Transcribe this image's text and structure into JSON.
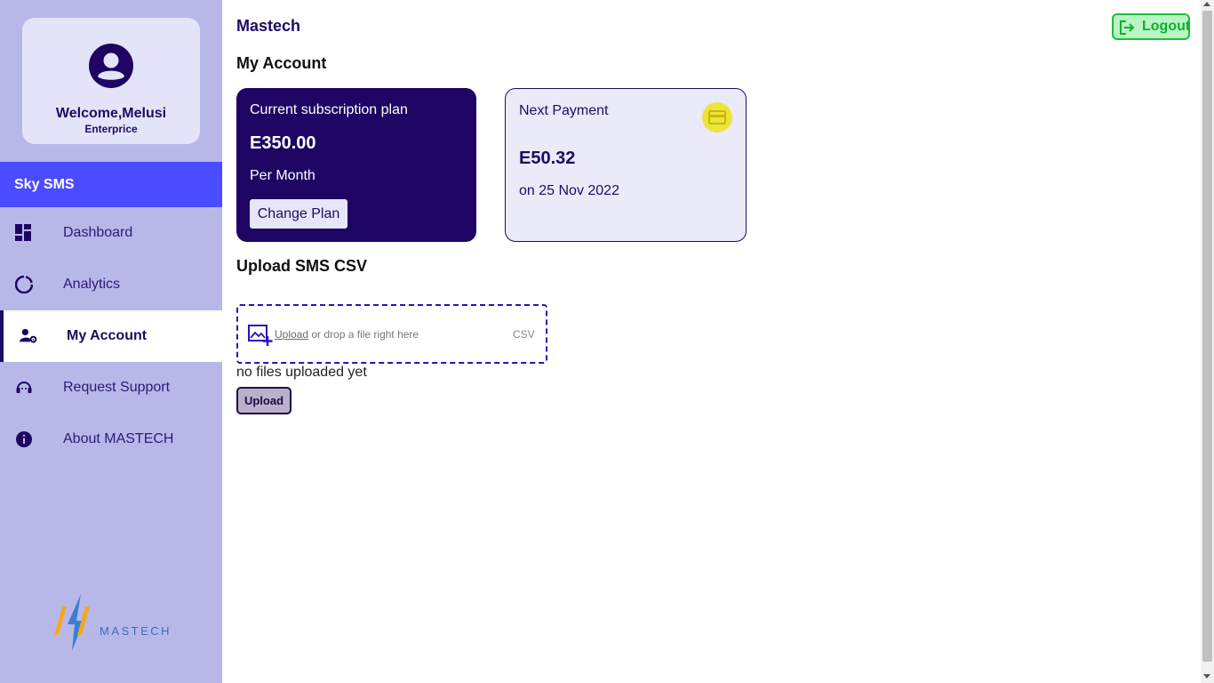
{
  "app": {
    "title": "Mastech"
  },
  "profile": {
    "welcome": "Welcome,Melusi",
    "tier": "Enterprice"
  },
  "sidebar": {
    "brand": "Sky SMS",
    "items": [
      {
        "label": "Dashboard",
        "icon": "dashboard-icon",
        "active": false
      },
      {
        "label": "Analytics",
        "icon": "analytics-icon",
        "active": false
      },
      {
        "label": "My Account",
        "icon": "account-settings-icon",
        "active": true
      },
      {
        "label": "Request Support",
        "icon": "support-headset-icon",
        "active": false
      },
      {
        "label": "About MASTECH",
        "icon": "info-icon",
        "active": false
      }
    ],
    "logo_text": "MASTECH"
  },
  "header": {
    "logout_label": "Logout"
  },
  "main": {
    "page_title": "My Account",
    "plan_card": {
      "label": "Current subscription plan",
      "amount": "E350.00",
      "period": "Per Month",
      "change_button": "Change Plan"
    },
    "payment_card": {
      "label": "Next Payment",
      "amount": "E50.32",
      "date": "on 25 Nov 2022",
      "icon": "credit-card-icon"
    },
    "upload": {
      "title": "Upload SMS CSV",
      "link_text": "Upload",
      "drop_text": " or drop a file right here",
      "file_type": "CSV",
      "status": "no files uploaded yet",
      "button": "Upload"
    }
  },
  "colors": {
    "sidebar_bg": "#b8b8e8",
    "brand_bar": "#4b4bff",
    "primary_dark": "#1e0563",
    "logout_green": "#1cbf3a",
    "card_icon_yellow": "#eee33a"
  }
}
